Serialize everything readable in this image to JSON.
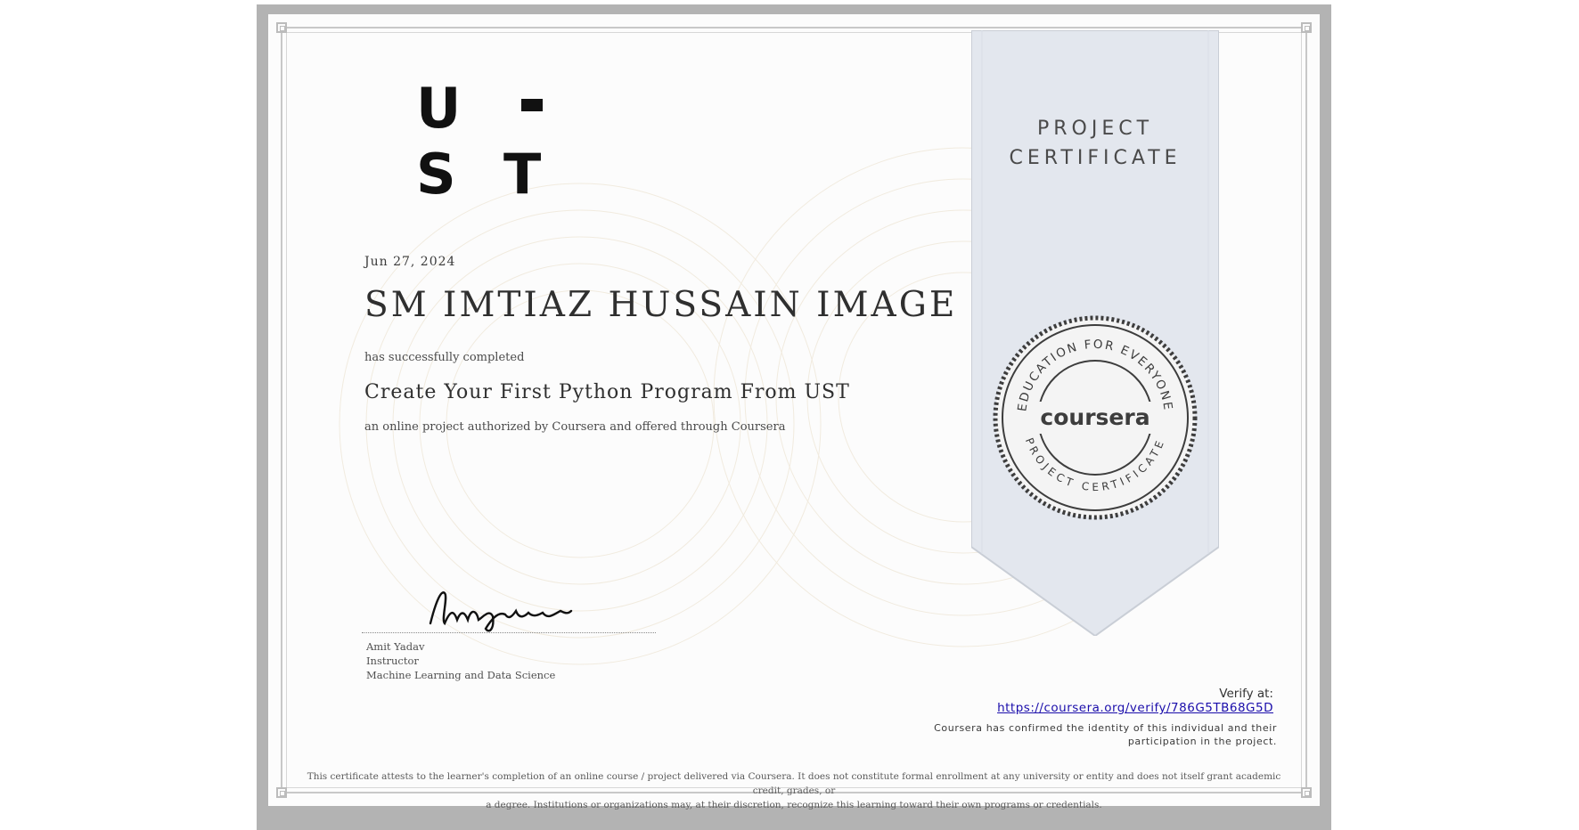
{
  "logo": {
    "text": "UST",
    "icon": "ust-logo"
  },
  "date": "Jun 27, 2024",
  "recipient": "SM IMTIAZ HUSSAIN IMAGE",
  "completed_text": "has successfully completed",
  "course": "Create Your First Python Program From UST",
  "authorized_text": "an online project authorized by Coursera and offered through Coursera",
  "instructor": {
    "name": "Amit Yadav",
    "role": "Instructor",
    "department": "Machine Learning and Data Science",
    "signature_icon": "handwritten-signature"
  },
  "ribbon": {
    "line1": "PROJECT",
    "line2": "CERTIFICATE"
  },
  "seal": {
    "brand": "coursera",
    "top_text": "EDUCATION FOR EVERYONE",
    "bottom_text": "PROJECT CERTIFICATE",
    "icon": "coursera-seal"
  },
  "verify": {
    "label": "Verify at:",
    "url": "https://coursera.org/verify/786G5TB68G5D"
  },
  "confirm": {
    "line1": "Coursera has confirmed the identity of this individual and their",
    "line2": "participation in the project."
  },
  "footer": {
    "line1": "This certificate attests to the learner's completion of an online course / project delivered via Coursera. It does not constitute formal enrollment at any university or entity and does not itself grant academic credit, grades, or",
    "line2": "a degree. Institutions or organizations may, at their discretion, recognize this learning toward their own programs or credentials."
  },
  "colors": {
    "ribbon": "#e3e7ee",
    "ribbon_edge": "#c9ced6",
    "seal": "#3d3d3d",
    "link": "#1a0dab"
  }
}
